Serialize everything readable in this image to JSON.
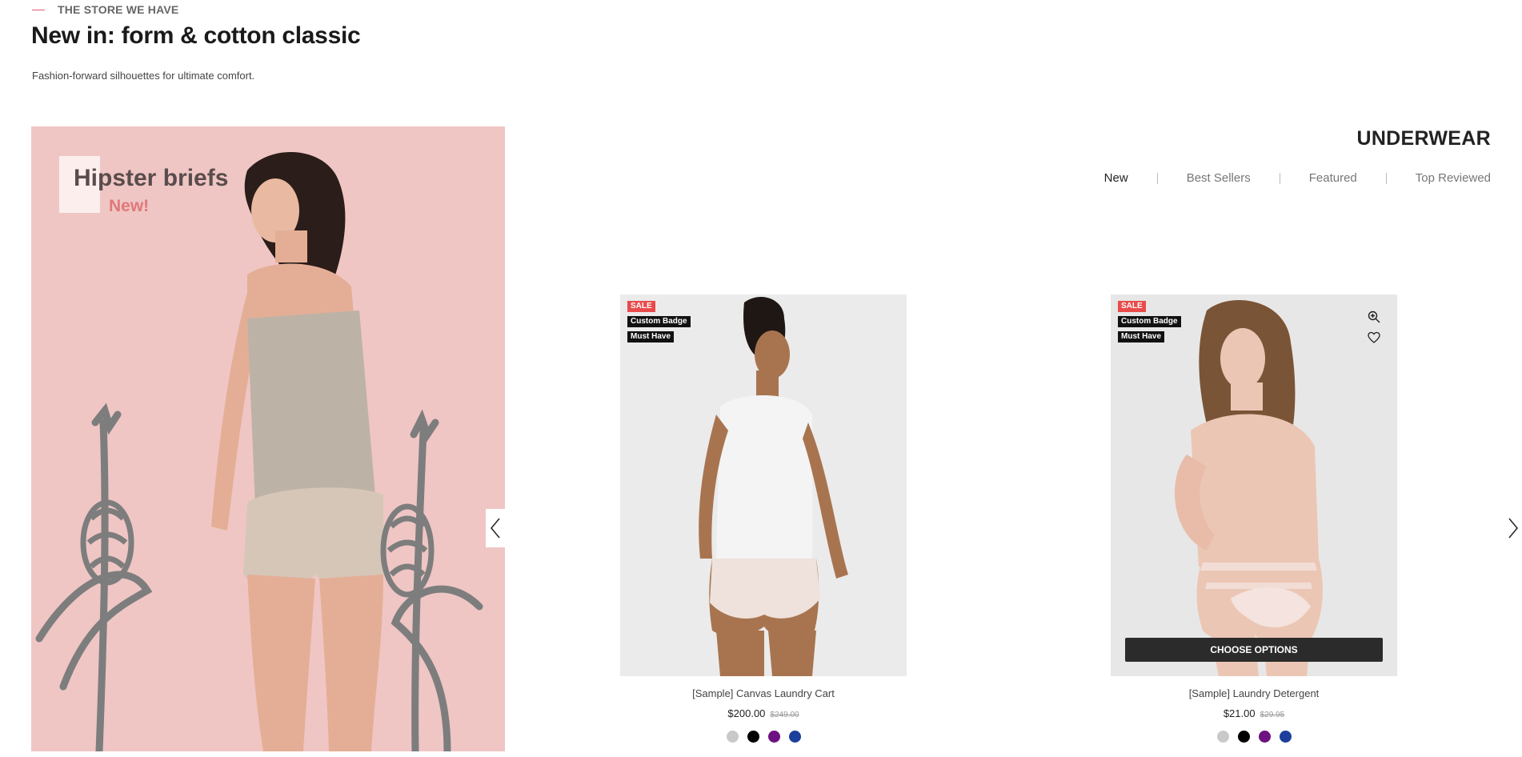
{
  "header": {
    "eyebrow": "THE STORE WE HAVE",
    "title": "New in: form & cotton classic",
    "subtitle": "Fashion-forward silhouettes for ultimate comfort."
  },
  "banner": {
    "title": "Hipster briefs",
    "tag": "New!",
    "prev_icon": "chevron-left-icon"
  },
  "section": {
    "title": "UNDERWEAR",
    "tabs": [
      {
        "label": "New",
        "active": true
      },
      {
        "label": "Best Sellers",
        "active": false
      },
      {
        "label": "Featured",
        "active": false
      },
      {
        "label": "Top Reviewed",
        "active": false
      }
    ]
  },
  "products": [
    {
      "name": "[Sample] Canvas Laundry Cart",
      "price": "$200.00",
      "old_price": "$249.00",
      "badges": [
        "SALE",
        "Custom Badge",
        "Must Have"
      ],
      "swatches": [
        "#c9c9c9",
        "#000000",
        "#6d1280",
        "#1b3f9a"
      ]
    },
    {
      "name": "[Sample] Laundry Detergent",
      "price": "$21.00",
      "old_price": "$29.95",
      "badges": [
        "SALE",
        "Custom Badge",
        "Must Have"
      ],
      "action_label": "CHOOSE OPTIONS",
      "quick_icons": [
        "zoom-in-icon",
        "heart-icon"
      ],
      "swatches": [
        "#c9c9c9",
        "#000000",
        "#6d1280",
        "#1b3f9a"
      ]
    }
  ],
  "carousel": {
    "next_icon": "chevron-right-icon"
  },
  "colors": {
    "accent": "#e25a6a",
    "banner_bg": "#efc6c4",
    "sale": "#e94b4b"
  }
}
